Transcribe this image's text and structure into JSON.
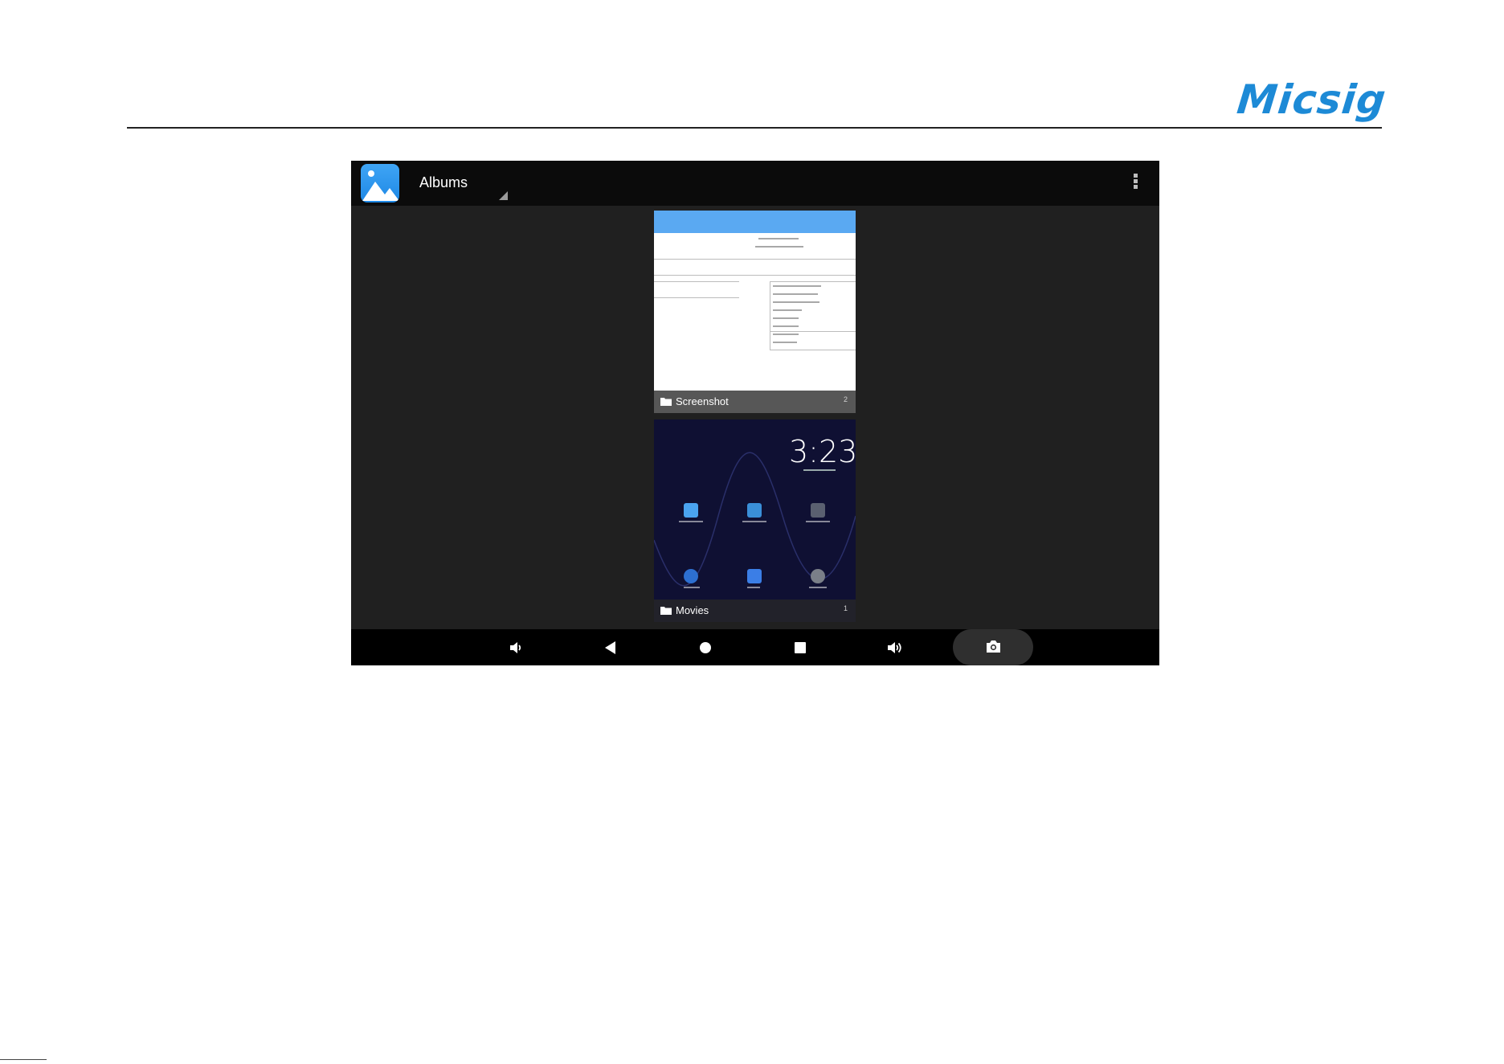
{
  "document": {
    "logo_text": "Micsig"
  },
  "app": {
    "title": "Albums",
    "icon": "gallery-icon",
    "overflow_menu_icon": "more-vert-icon"
  },
  "albums": [
    {
      "name": "Screenshot",
      "count": "2",
      "thumbnail": "app-settings-screenshot"
    },
    {
      "name": "Movies",
      "count": "1",
      "thumbnail": "home-screen-screenshot"
    }
  ],
  "home_screen_thumb": {
    "clock": "3:23"
  },
  "navbar": {
    "buttons": [
      {
        "name": "volume-down-icon"
      },
      {
        "name": "back-icon"
      },
      {
        "name": "home-icon"
      },
      {
        "name": "recents-icon"
      },
      {
        "name": "volume-up-icon"
      },
      {
        "name": "camera-icon"
      }
    ]
  },
  "colors": {
    "brand": "#1d8ad6",
    "topbar": "#0b0b0b",
    "background": "#202020",
    "accent": "#5aa9f2"
  }
}
